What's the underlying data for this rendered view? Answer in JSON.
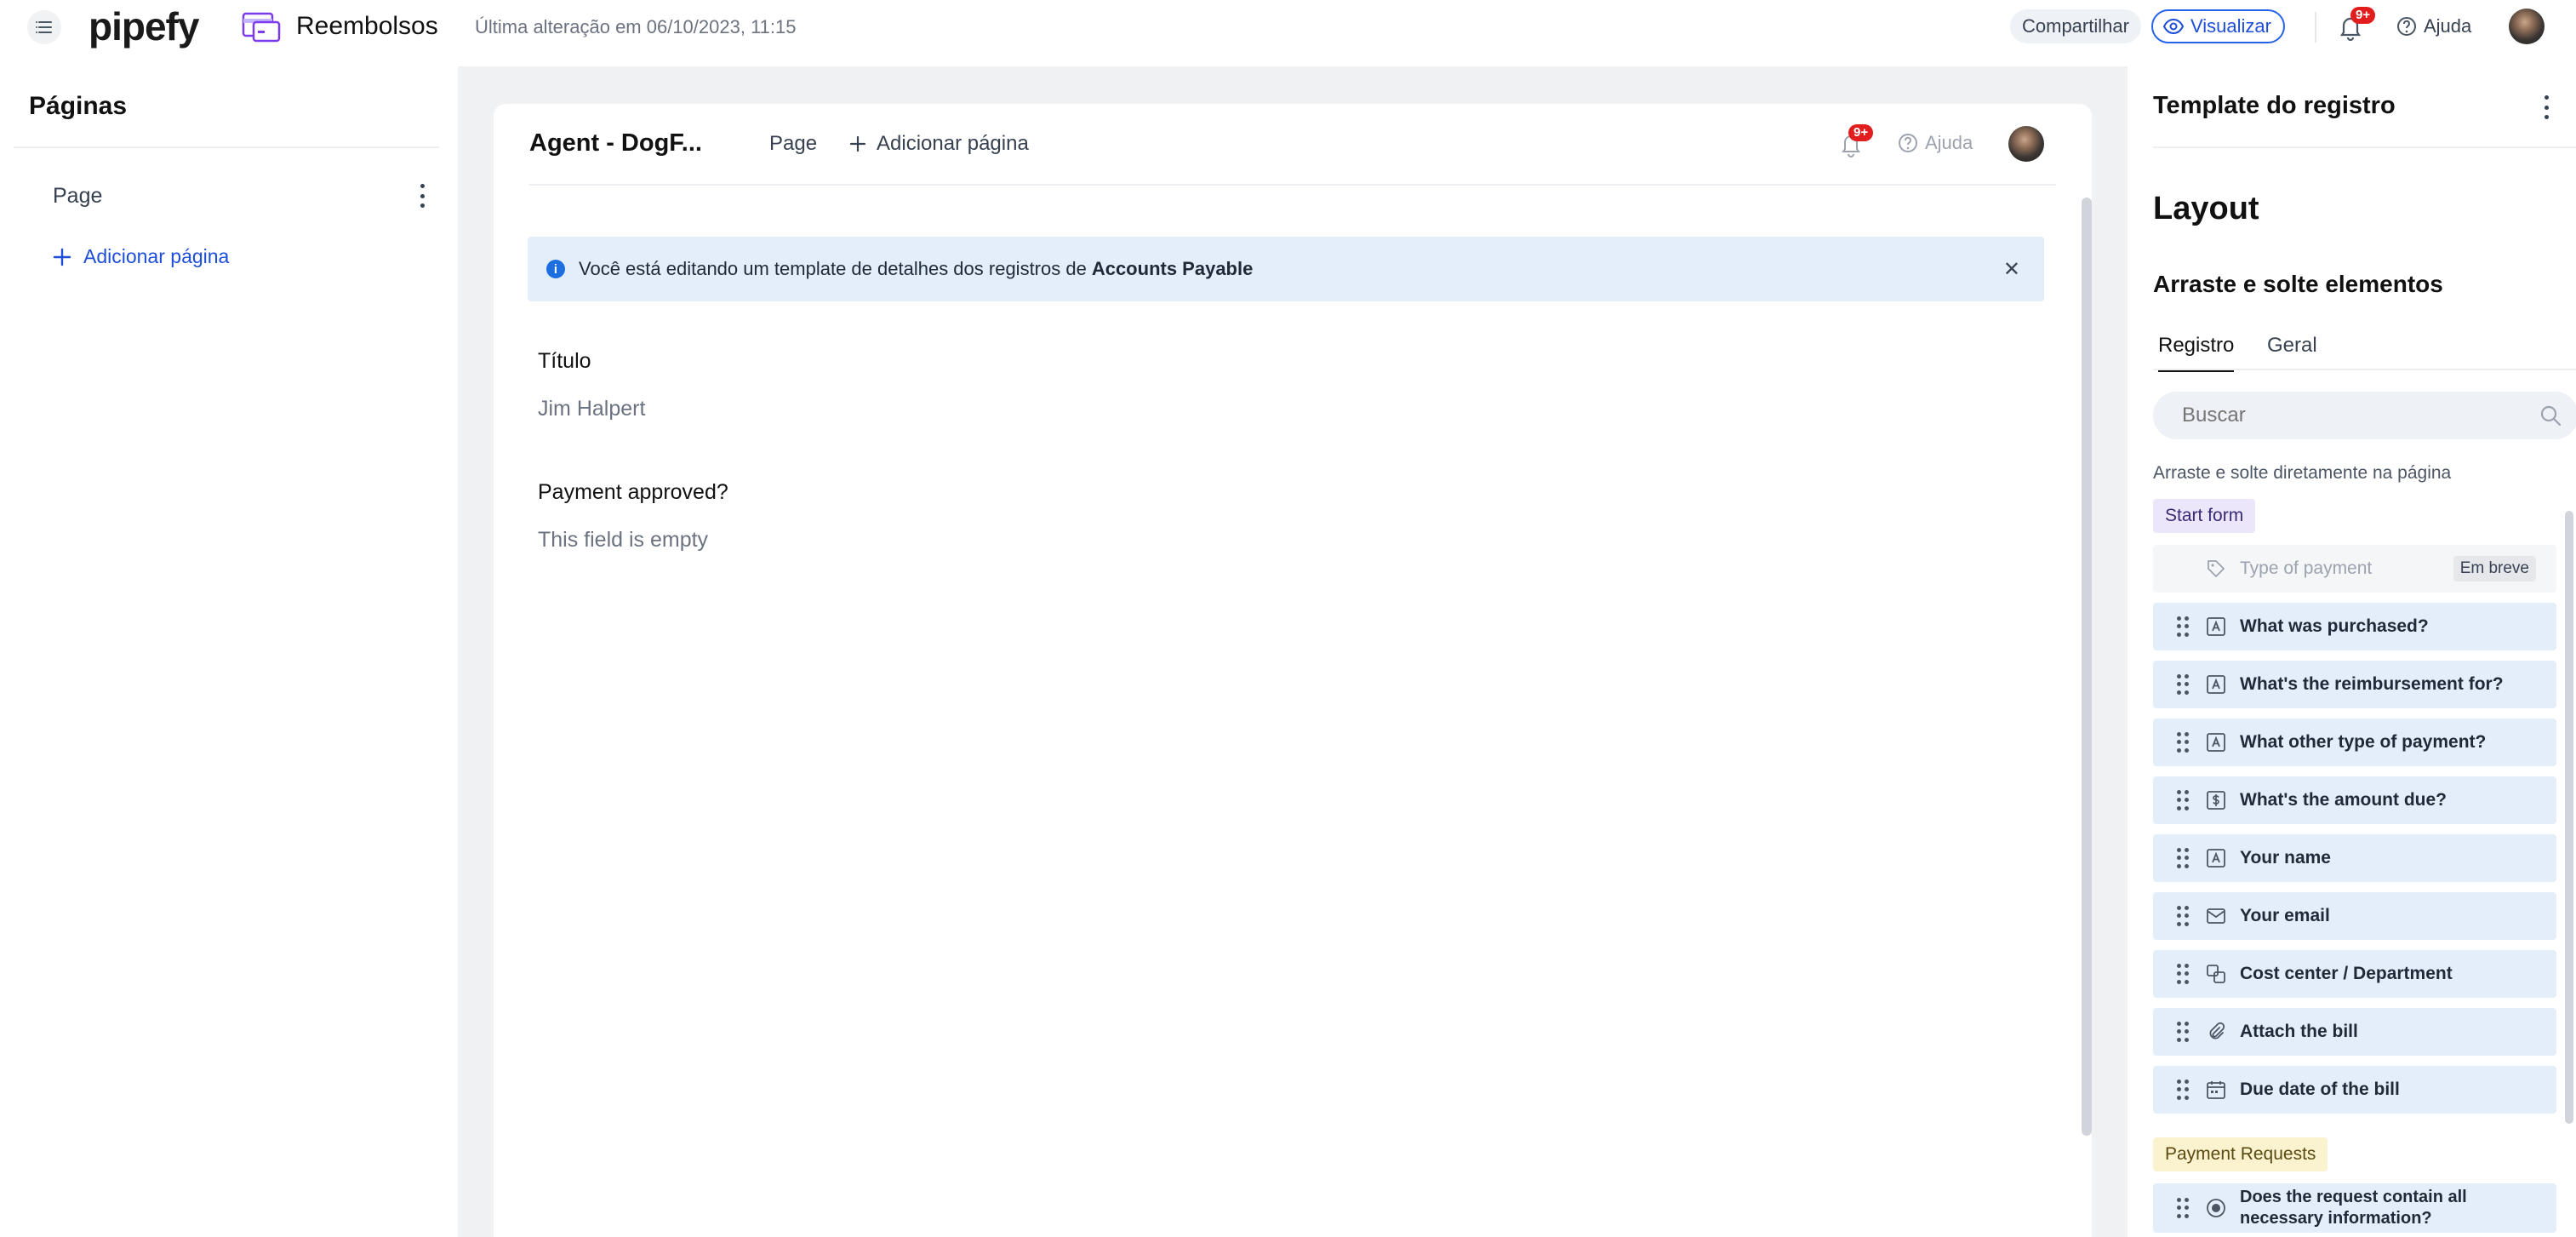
{
  "topbar": {
    "logo": "pipefy",
    "pipe_name": "Reembolsos",
    "last_change": "Última alteração em 06/10/2023, 11:15",
    "share_label": "Compartilhar",
    "view_label": "Visualizar",
    "notification_badge": "9+",
    "help_label": "Ajuda"
  },
  "left_panel": {
    "title": "Páginas",
    "pages": [
      {
        "label": "Page"
      }
    ],
    "add_page_label": "Adicionar página"
  },
  "canvas": {
    "title": "Agent - DogF...",
    "page_tab": "Page",
    "add_page_label": "Adicionar página",
    "notification_badge": "9+",
    "help_label": "Ajuda",
    "info_text": "Você está editando um template de detalhes dos registros de",
    "info_bold": "Accounts Payable",
    "fields": [
      {
        "label": "Título",
        "value": "Jim Halpert"
      },
      {
        "label": "Payment approved?",
        "value": "This field is empty"
      }
    ]
  },
  "right_panel": {
    "title": "Template do registro",
    "layout_heading": "Layout",
    "drag_heading": "Arraste e solte elementos",
    "tabs": [
      {
        "label": "Registro",
        "active": true
      },
      {
        "label": "Geral",
        "active": false
      }
    ],
    "search_placeholder": "Buscar",
    "hint": "Arraste e solte diretamente na página",
    "groups": [
      {
        "name": "Start form",
        "items": [
          {
            "label": "Type of payment",
            "icon": "tag-icon",
            "disabled": true,
            "badge": "Em breve"
          },
          {
            "label": "What was purchased?",
            "icon": "text-field-icon"
          },
          {
            "label": "What's the reimbursement for?",
            "icon": "text-field-icon"
          },
          {
            "label": "What other type of payment?",
            "icon": "text-field-icon"
          },
          {
            "label": "What's the amount due?",
            "icon": "currency-icon"
          },
          {
            "label": "Your name",
            "icon": "text-field-icon"
          },
          {
            "label": "Your email",
            "icon": "email-icon"
          },
          {
            "label": "Cost center / Department",
            "icon": "connection-icon"
          },
          {
            "label": "Attach the bill",
            "icon": "paperclip-icon"
          },
          {
            "label": "Due date of the bill",
            "icon": "calendar-icon"
          }
        ]
      },
      {
        "name": "Payment Requests",
        "items": [
          {
            "label": "Does the request contain all necessary information?",
            "icon": "radio-icon"
          }
        ]
      }
    ]
  },
  "colors": {
    "accent_blue": "#1d4ed8",
    "info_bg": "#e4eefb",
    "badge_red": "#e11d1d",
    "start_form_tag": "#ece6fb",
    "payment_requests_tag": "#fbf3d0"
  }
}
